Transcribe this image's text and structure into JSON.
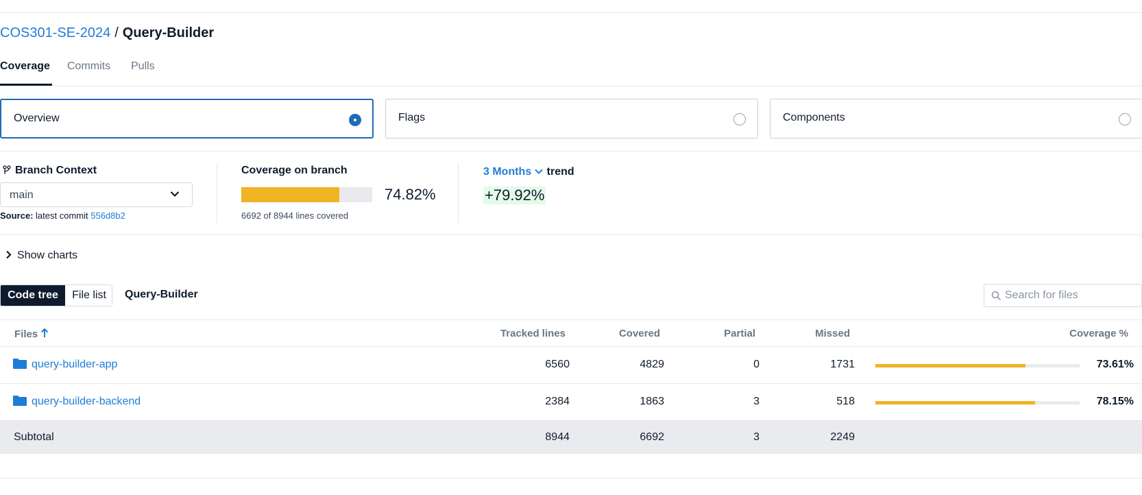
{
  "breadcrumb": {
    "org": "COS301-SE-2024",
    "separator": "/",
    "repo": "Query-Builder"
  },
  "tabs": [
    {
      "label": "Coverage",
      "active": true
    },
    {
      "label": "Commits",
      "active": false
    },
    {
      "label": "Pulls",
      "active": false
    }
  ],
  "selectors": [
    {
      "label": "Overview",
      "selected": true
    },
    {
      "label": "Flags",
      "selected": false
    },
    {
      "label": "Components",
      "selected": false
    }
  ],
  "branch_context": {
    "title": "Branch Context",
    "value": "main",
    "source_label": "Source:",
    "source_text": "latest commit",
    "commit": "556d8b2"
  },
  "coverage": {
    "title": "Coverage on branch",
    "percent_text": "74.82%",
    "percent": 74.82,
    "lines_text": "6692 of 8944 lines covered"
  },
  "trend": {
    "period": "3 Months",
    "label": "trend",
    "value": "+79.92%"
  },
  "show_charts": "Show charts",
  "view_toggle": {
    "code_tree": "Code tree",
    "file_list": "File list"
  },
  "tree_crumb": "Query-Builder",
  "search": {
    "placeholder": "Search for files"
  },
  "table": {
    "headers": {
      "files": "Files",
      "tracked": "Tracked lines",
      "covered": "Covered",
      "partial": "Partial",
      "missed": "Missed",
      "coverage": "Coverage %"
    },
    "rows": [
      {
        "name": "query-builder-app",
        "tracked": "6560",
        "covered": "4829",
        "partial": "0",
        "missed": "1731",
        "coverage_text": "73.61%",
        "coverage": 73.61
      },
      {
        "name": "query-builder-backend",
        "tracked": "2384",
        "covered": "1863",
        "partial": "3",
        "missed": "518",
        "coverage_text": "78.15%",
        "coverage": 78.15
      }
    ],
    "subtotal": {
      "label": "Subtotal",
      "tracked": "8944",
      "covered": "6692",
      "partial": "3",
      "missed": "2249"
    }
  },
  "colors": {
    "accent": "#1e6bb8",
    "link": "#1e7dd6",
    "coverage_bar": "#f0b323",
    "trend_bg": "#e3fbe9"
  }
}
